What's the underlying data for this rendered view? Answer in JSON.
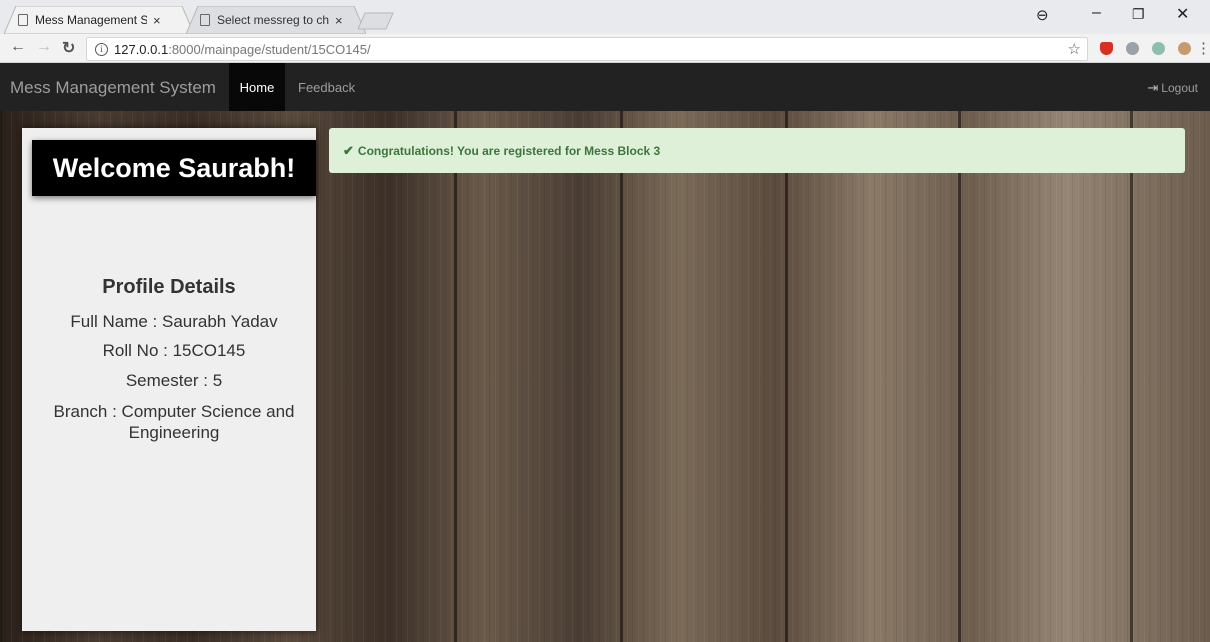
{
  "browser": {
    "tabs": [
      {
        "title": "Mess Management Syste",
        "close": "×"
      },
      {
        "title": "Select messreg to chang",
        "close": "×"
      }
    ],
    "url_host": "127.0.0.1",
    "url_path": ":8000/mainpage/student/15CO145/",
    "info_glyph": "i",
    "icons": [
      "page-icon",
      "info-icon",
      "star-icon",
      "menu-icon",
      "profile-icon"
    ]
  },
  "navbar": {
    "brand": "Mess Management System",
    "home": "Home",
    "feedback": "Feedback",
    "logout": "Logout"
  },
  "sidebar": {
    "welcome": "Welcome Saurabh!",
    "profile_title": "Profile Details",
    "full_name": "Full Name : Saurabh Yadav",
    "roll_no": "Roll No : 15CO145",
    "semester": "Semester : 5",
    "branch": "Branch : Computer Science and Engineering"
  },
  "alert": {
    "text": "Congratulations! You are registered for Mess Block 3"
  },
  "colors": {
    "navbar": "#222222",
    "alert_bg": "#dff0d8",
    "alert_text": "#3c763d"
  }
}
